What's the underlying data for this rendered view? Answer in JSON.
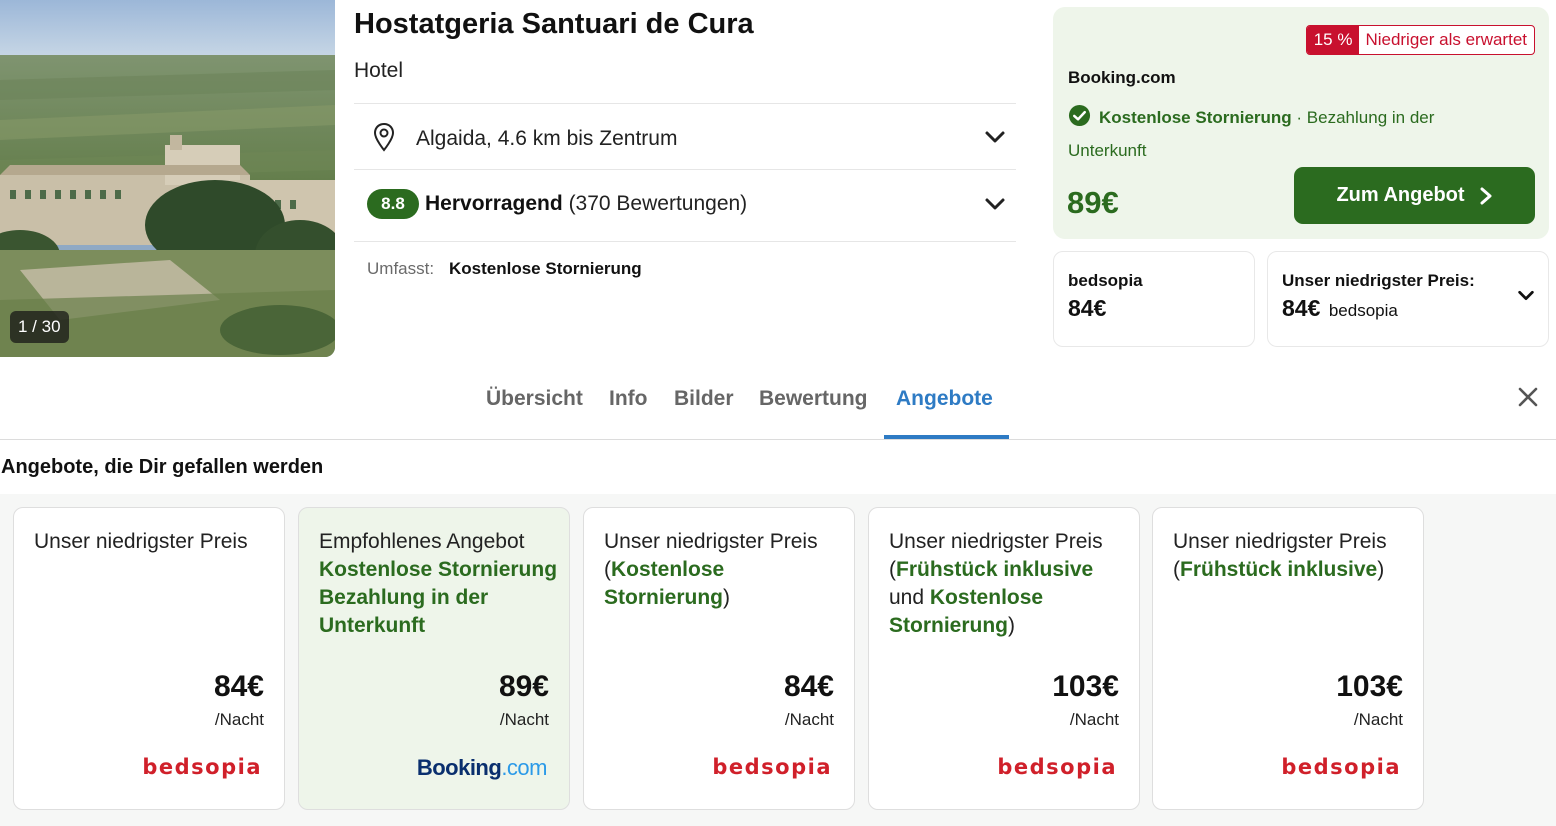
{
  "hero": {
    "photo_counter": "1 / 30"
  },
  "hotel": {
    "name": "Hostatgeria Santuari de Cura",
    "type": "Hotel",
    "location": "Algaida, 4.6 km bis Zentrum",
    "rating_score": "8.8",
    "rating_label": "Hervorragend",
    "rating_count": "(370 Bewertungen)",
    "includes_label": "Umfasst:",
    "includes_value": "Kostenlose Stornierung"
  },
  "best_deal": {
    "badge_percent": "15 %",
    "badge_text": "Niedriger als erwartet",
    "provider": "Booking.com",
    "cancellation": "Kostenlose Stornierung",
    "payment": "· Bezahlung in der Unterkunft",
    "price": "89€",
    "cta_label": "Zum Angebot",
    "accent_color": "#2b6b1f",
    "badge_color": "#c8102e"
  },
  "secondary_prices": {
    "provider_box": {
      "label": "bedsopia",
      "price": "84€"
    },
    "lowest_box": {
      "label": "Unser niedrigster Preis:",
      "price": "84€",
      "provider": "bedsopia"
    }
  },
  "tabs": {
    "items": [
      "Übersicht",
      "Info",
      "Bilder",
      "Bewertung",
      "Angebote"
    ],
    "active": "Angebote",
    "active_color": "#2e7bc4"
  },
  "offers": {
    "section_title": "Angebote, die Dir gefallen werden",
    "cards": [
      {
        "title_parts": [
          "Unser niedrigster Preis"
        ],
        "price": "84€",
        "unit": "/Nacht",
        "provider": "bedsopia"
      },
      {
        "title_parts": [
          "Empfohlenes Angebot",
          "Kostenlose Stornierung",
          "Bezahlung in der Unterkunft"
        ],
        "price": "89€",
        "unit": "/Nacht",
        "provider_main": "Booking",
        "provider_suffix": ".com"
      },
      {
        "title_parts": [
          "Unser niedrigster Preis",
          "(",
          "Kostenlose Stornierung",
          ")"
        ],
        "price": "84€",
        "unit": "/Nacht",
        "provider": "bedsopia"
      },
      {
        "title_parts": [
          "Unser niedrigster Preis",
          "(",
          "Frühstück inklusive",
          "und",
          "Kostenlose Stornierung",
          ")"
        ],
        "price": "103€",
        "unit": "/Nacht",
        "provider": "bedsopia"
      },
      {
        "title_parts": [
          "Unser niedrigster Preis",
          "(",
          "Frühstück inklusive",
          ")"
        ],
        "price": "103€",
        "unit": "/Nacht",
        "provider": "bedsopia"
      }
    ]
  }
}
